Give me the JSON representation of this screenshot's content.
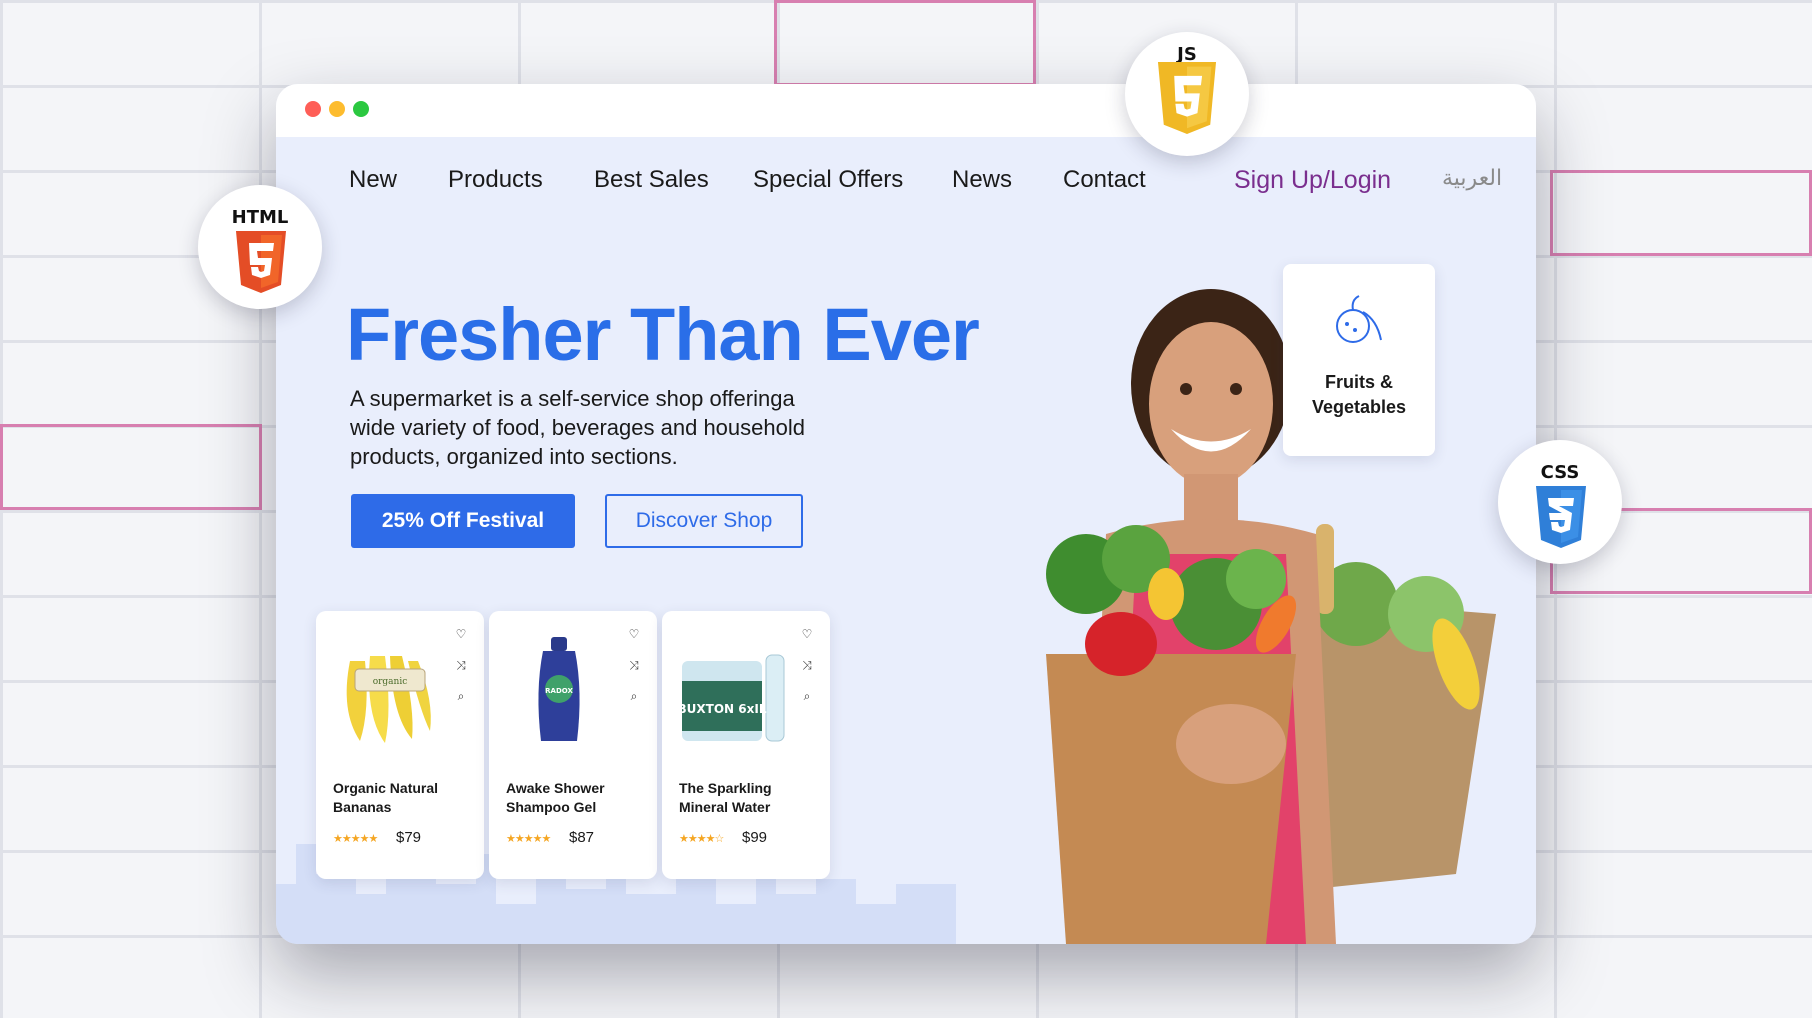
{
  "nav": {
    "items": [
      {
        "label": "New"
      },
      {
        "label": "Products"
      },
      {
        "label": "Best Sales"
      },
      {
        "label": "Special Offers"
      },
      {
        "label": "News"
      },
      {
        "label": "Contact"
      }
    ],
    "signup_label": "Sign Up/Login",
    "language_label": "العربية"
  },
  "hero": {
    "title": "Fresher Than Ever",
    "description": "A supermarket is a self-service shop offeringa wide variety of food, beverages and household products, organized into sections.",
    "primary_button": "25% Off Festival",
    "secondary_button": "Discover Shop"
  },
  "products": [
    {
      "name": "Organic Natural Bananas",
      "price": "$79",
      "rating": 5,
      "image_label": "organic"
    },
    {
      "name": "Awake Shower Shampoo Gel",
      "price": "$87",
      "rating": 5,
      "image_label": "RADOX"
    },
    {
      "name": "The Sparkling Mineral Water",
      "price": "$99",
      "rating": 4,
      "image_label": "BUXTON 6xIL"
    }
  ],
  "category": {
    "label": "Fruits & Vegetables"
  },
  "badges": {
    "html": "HTML",
    "js": "JS",
    "css": "CSS"
  },
  "colors": {
    "accent": "#2e6be8",
    "title": "#2a6ee8",
    "signup": "#7a2e8e",
    "browser_bg": "#e9eefc",
    "html5": "#e44d26",
    "js": "#f0b825",
    "css3": "#2f7fd8"
  },
  "icons": [
    "heart-icon",
    "shuffle-icon",
    "search-icon",
    "fruit-basket-icon"
  ]
}
